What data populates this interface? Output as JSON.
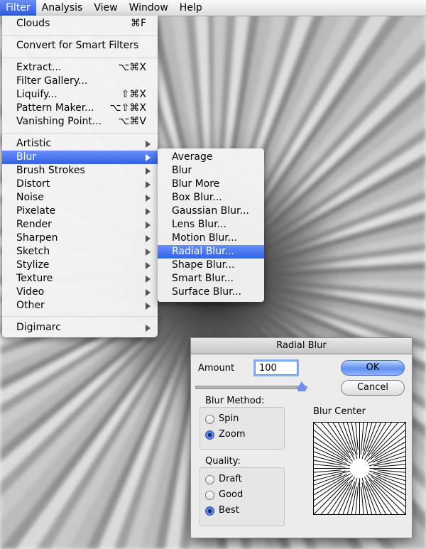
{
  "menubar": {
    "items": [
      "Filter",
      "Analysis",
      "View",
      "Window",
      "Help"
    ]
  },
  "filter_menu": {
    "items": [
      {
        "label": "Clouds",
        "shortcut": "⌘F"
      },
      {
        "label": "Convert for Smart Filters",
        "shortcut": ""
      },
      {
        "label": "Extract...",
        "shortcut": "⌥⌘X"
      },
      {
        "label": "Filter Gallery...",
        "shortcut": ""
      },
      {
        "label": "Liquify...",
        "shortcut": "⇧⌘X"
      },
      {
        "label": "Pattern Maker...",
        "shortcut": "⌥⇧⌘X"
      },
      {
        "label": "Vanishing Point...",
        "shortcut": "⌥⌘V"
      },
      {
        "label": "Artistic",
        "shortcut": ""
      },
      {
        "label": "Blur",
        "shortcut": ""
      },
      {
        "label": "Brush Strokes",
        "shortcut": ""
      },
      {
        "label": "Distort",
        "shortcut": ""
      },
      {
        "label": "Noise",
        "shortcut": ""
      },
      {
        "label": "Pixelate",
        "shortcut": ""
      },
      {
        "label": "Render",
        "shortcut": ""
      },
      {
        "label": "Sharpen",
        "shortcut": ""
      },
      {
        "label": "Sketch",
        "shortcut": ""
      },
      {
        "label": "Stylize",
        "shortcut": ""
      },
      {
        "label": "Texture",
        "shortcut": ""
      },
      {
        "label": "Video",
        "shortcut": ""
      },
      {
        "label": "Other",
        "shortcut": ""
      },
      {
        "label": "Digimarc",
        "shortcut": ""
      }
    ]
  },
  "blur_submenu": {
    "items": [
      "Average",
      "Blur",
      "Blur More",
      "Box Blur...",
      "Gaussian Blur...",
      "Lens Blur...",
      "Motion Blur...",
      "Radial Blur...",
      "Shape Blur...",
      "Smart Blur...",
      "Surface Blur..."
    ]
  },
  "dialog": {
    "title": "Radial Blur",
    "amount_label": "Amount",
    "amount_value": "100",
    "ok_label": "OK",
    "cancel_label": "Cancel",
    "blur_method_label": "Blur Method:",
    "blur_method_options": [
      "Spin",
      "Zoom"
    ],
    "blur_method_selected": "Zoom",
    "quality_label": "Quality:",
    "quality_options": [
      "Draft",
      "Good",
      "Best"
    ],
    "quality_selected": "Best",
    "blur_center_label": "Blur Center",
    "amount_slider_fraction": 1.0
  },
  "colors": {
    "highlight": "#3062ea",
    "menubar_active": "#2c5be8"
  },
  "icons": {
    "submenu_arrow": "triangle-right-icon",
    "radio": "radio-button-icon"
  }
}
